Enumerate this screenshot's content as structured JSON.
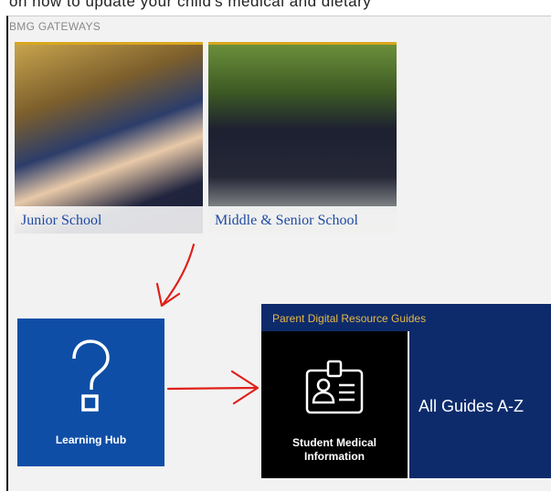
{
  "header_fragment": "on how to update your child's medical and dietary",
  "gateway": {
    "title": "BMG GATEWAYS",
    "tiles": [
      {
        "label": "Junior School"
      },
      {
        "label": "Middle & Senior School"
      }
    ]
  },
  "learning_hub": {
    "label": "Learning Hub",
    "icon": "question-mark-icon"
  },
  "resource_guides": {
    "title": "Parent Digital Resource Guides",
    "tiles": [
      {
        "label": "Student Medical Information",
        "icon": "id-badge-icon"
      },
      {
        "label": "All Guides A-Z"
      }
    ]
  },
  "colors": {
    "gold": "#d9a61e",
    "navy": "#0d2b6b",
    "learning_blue": "#0e4ea6",
    "arrow_red": "#e0201a",
    "guides_title": "#e6b94a"
  }
}
